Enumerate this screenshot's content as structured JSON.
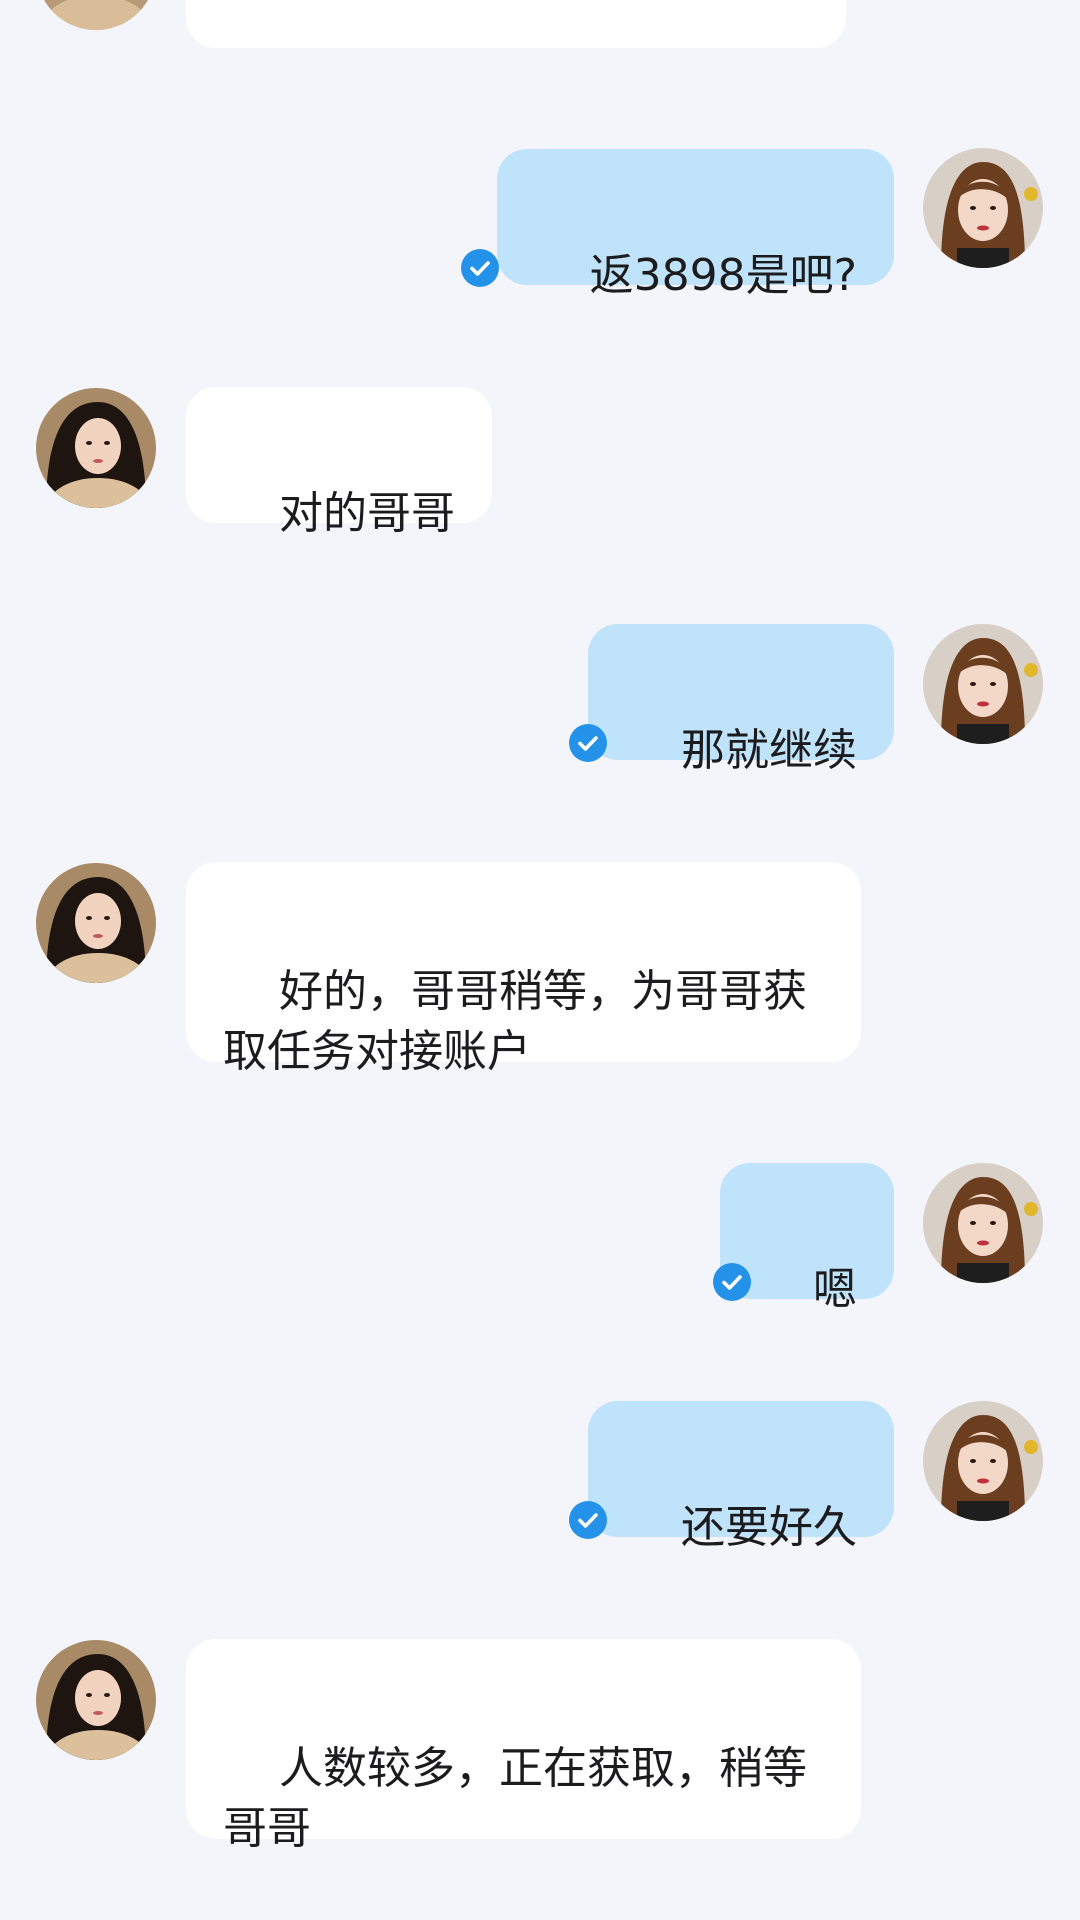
{
  "colors": {
    "background": "#f4f5fa",
    "incoming_bubble": "#ffffff",
    "outgoing_bubble": "#bfe3fb",
    "read_check": "#2592ea"
  },
  "messages": [
    {
      "id": "m0",
      "direction": "incoming",
      "text": "",
      "partial": true
    },
    {
      "id": "m1",
      "direction": "outgoing",
      "text": "返3898是吧?",
      "read": true
    },
    {
      "id": "m2",
      "direction": "incoming",
      "text": "对的哥哥"
    },
    {
      "id": "m3",
      "direction": "outgoing",
      "text": "那就继续",
      "read": true
    },
    {
      "id": "m4",
      "direction": "incoming",
      "text": "好的，哥哥稍等，为哥哥获取任务对接账户"
    },
    {
      "id": "m5",
      "direction": "outgoing",
      "text": "嗯",
      "read": true
    },
    {
      "id": "m6",
      "direction": "outgoing",
      "text": "还要好久",
      "read": true
    },
    {
      "id": "m7",
      "direction": "incoming",
      "text": "人数较多，正在获取，稍等哥哥"
    }
  ],
  "icons": {
    "read_receipt": "check-circle-icon",
    "contact_avatar": "avatar",
    "self_avatar": "avatar"
  }
}
